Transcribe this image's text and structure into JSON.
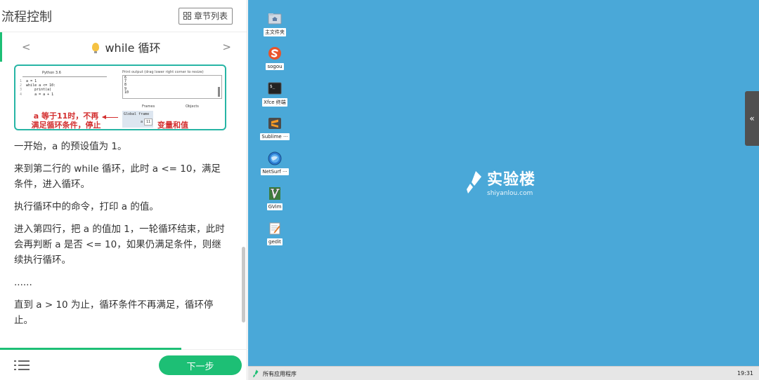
{
  "left": {
    "title": "流程控制",
    "chapter_button": "章节列表",
    "nav": {
      "prev": "<",
      "next": ">",
      "lesson_title": "while 循环"
    },
    "viz": {
      "python_version": "Python 3.6",
      "code_lines": [
        {
          "num": "1",
          "text": "a = 1"
        },
        {
          "num": "2",
          "text": "while a <= 10:"
        },
        {
          "num": "3",
          "text": "    print(a)"
        },
        {
          "num": "4",
          "text": "    a = a + 1"
        }
      ],
      "output_label": "Print output (drag lower right corner to resize)",
      "output": "6\n7\n8\n9\n10",
      "frames_label": "Frames",
      "objects_label": "Objects",
      "global_frame_label": "Global frame",
      "var_name": "a",
      "var_value": "11",
      "note_left_line1": "a 等于11时，不再",
      "note_left_line2": "满足循环条件，停止",
      "note_right": "变量和值"
    },
    "paragraphs": [
      "一开始，a 的预设值为 1。",
      "来到第二行的 while 循环，此时 a <= 10，满足条件，进入循环。",
      "执行循环中的命令，打印 a 的值。",
      "进入第四行，把 a 的值加 1，一轮循环结束，此时会再判断 a 是否 <= 10，如果仍满足条件，则继续执行循环。",
      "......",
      "直到 a > 10 为止，循环条件不再满足，循环停止。"
    ],
    "next_button": "下一步"
  },
  "desktop": {
    "icons": [
      {
        "label": "主文件夹",
        "icon": "home-folder-icon"
      },
      {
        "label": "sogou",
        "icon": "sogou-icon"
      },
      {
        "label": "Xfce 终端",
        "icon": "terminal-icon"
      },
      {
        "label": "Sublime ···",
        "icon": "sublime-icon"
      },
      {
        "label": "NetSurf ···",
        "icon": "globe-icon"
      },
      {
        "label": "GVim",
        "icon": "vim-icon"
      },
      {
        "label": "gedit",
        "icon": "text-editor-icon"
      }
    ],
    "logo_cn": "实验楼",
    "logo_en": "shiyanlou.com",
    "side_handle": "«",
    "taskbar_start": "所有应用程序",
    "clock": "19:31"
  }
}
